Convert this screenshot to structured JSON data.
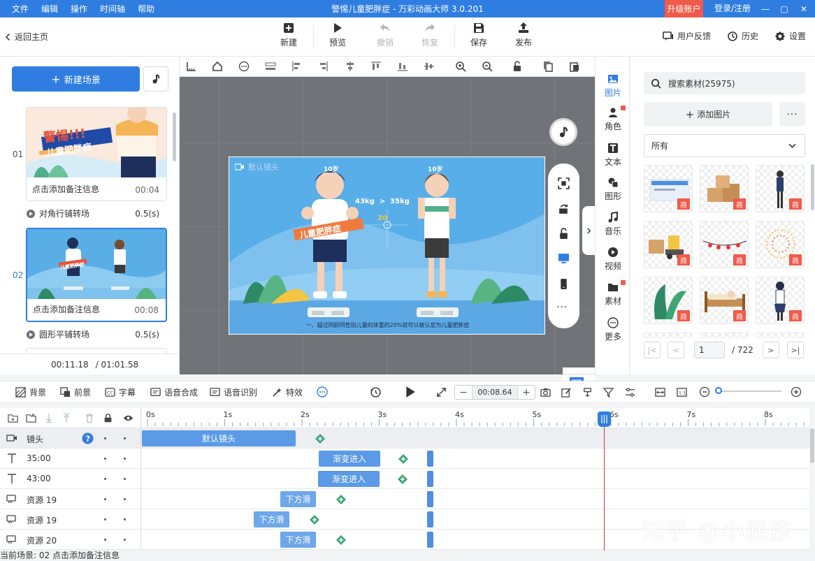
{
  "titlebar": {
    "menu": [
      "文件",
      "编辑",
      "操作",
      "时间轴",
      "帮助"
    ],
    "title": "警惕儿童肥胖症 - 万彩动画大师 3.0.201",
    "upgrade": "升级账户",
    "login": "登录/注册",
    "min": "—",
    "max": "▢",
    "close": "✕"
  },
  "toolbar": {
    "back": "返回主页",
    "new": "新建",
    "preview": "预览",
    "undo": "撤销",
    "redo": "恢复",
    "save": "保存",
    "publish": "发布",
    "feedback": "用户反馈",
    "history": "历史",
    "settings": "设置"
  },
  "scenes": {
    "new_scene": "新建场景",
    "items": [
      {
        "num": "01",
        "note": "点击添加备注信息",
        "dur": "00:04",
        "thumb_title": "警惕!!!",
        "thumb_sub": "儿童肥胖症",
        "transition": "对角行铺转场",
        "trans_val": "0.5(s)"
      },
      {
        "num": "02",
        "note": "点击添加备注信息",
        "dur": "00:08",
        "thumb_title": "儿童肥胖症",
        "transition": "圆形平铺转场",
        "trans_val": "0.5(s)"
      }
    ],
    "current_time": "00:11.18",
    "total_time": "/ 01:01.58"
  },
  "stage": {
    "camera_label": "默认镜头",
    "age_left": "10岁",
    "age_right": "10岁",
    "weights": "43kg  >  35kg",
    "diff": "20",
    "banner": "儿童肥胖症",
    "caption": "一、超过同龄同性别儿童的体重的20%就可以被认定为儿童肥胖症"
  },
  "categories": [
    {
      "label": "图片",
      "icon": "image-icon",
      "active": true
    },
    {
      "label": "角色",
      "icon": "character-icon",
      "new": true
    },
    {
      "label": "文本",
      "icon": "text-icon"
    },
    {
      "label": "图形",
      "icon": "shape-icon"
    },
    {
      "label": "音乐",
      "icon": "music-icon"
    },
    {
      "label": "视频",
      "icon": "video-icon"
    },
    {
      "label": "素材",
      "icon": "folder-icon",
      "new": true
    },
    {
      "label": "更多",
      "icon": "more-icon"
    }
  ],
  "materials": {
    "search_placeholder": "搜索素材(25975)",
    "add_image": "添加图片",
    "more": "···",
    "filter": "所有",
    "badge": "商",
    "page": "1",
    "total_pages": "/ 722"
  },
  "timeline_toolbar": {
    "background": "背景",
    "foreground": "前景",
    "subtitle": "字幕",
    "tts": "语音合成",
    "asr": "语音识别",
    "effects": "特效",
    "time": "00:08.64",
    "minus": "−",
    "plus": "+"
  },
  "ruler": [
    "0s",
    "1s",
    "2s",
    "3s",
    "4s",
    "5s",
    "6s",
    "7s",
    "8s"
  ],
  "tracks": [
    {
      "name": "镜头",
      "icon": "camera-icon",
      "clips": [
        {
          "label": "默认镜头"
        }
      ]
    },
    {
      "name": "35:00",
      "icon": "text-t-icon",
      "clips": [
        {
          "label": "渐变进入"
        }
      ]
    },
    {
      "name": "43:00",
      "icon": "text-t-icon",
      "clips": [
        {
          "label": "渐变进入"
        }
      ]
    },
    {
      "name": "资源 19",
      "icon": "resource-icon",
      "clips": [
        {
          "label": "下方滑"
        }
      ]
    },
    {
      "name": "资源 19",
      "icon": "resource-icon",
      "clips": [
        {
          "label": "下方滑"
        }
      ]
    },
    {
      "name": "资源 20",
      "icon": "resource-icon",
      "clips": [
        {
          "label": "下方滑"
        }
      ]
    }
  ],
  "status": "当前场景: 02   点击添加备注信息",
  "watermark": "知乎 @小屁孩",
  "colors": {
    "accent": "#2f7de1",
    "danger": "#f15a4a",
    "playhead": "#d9363e"
  }
}
